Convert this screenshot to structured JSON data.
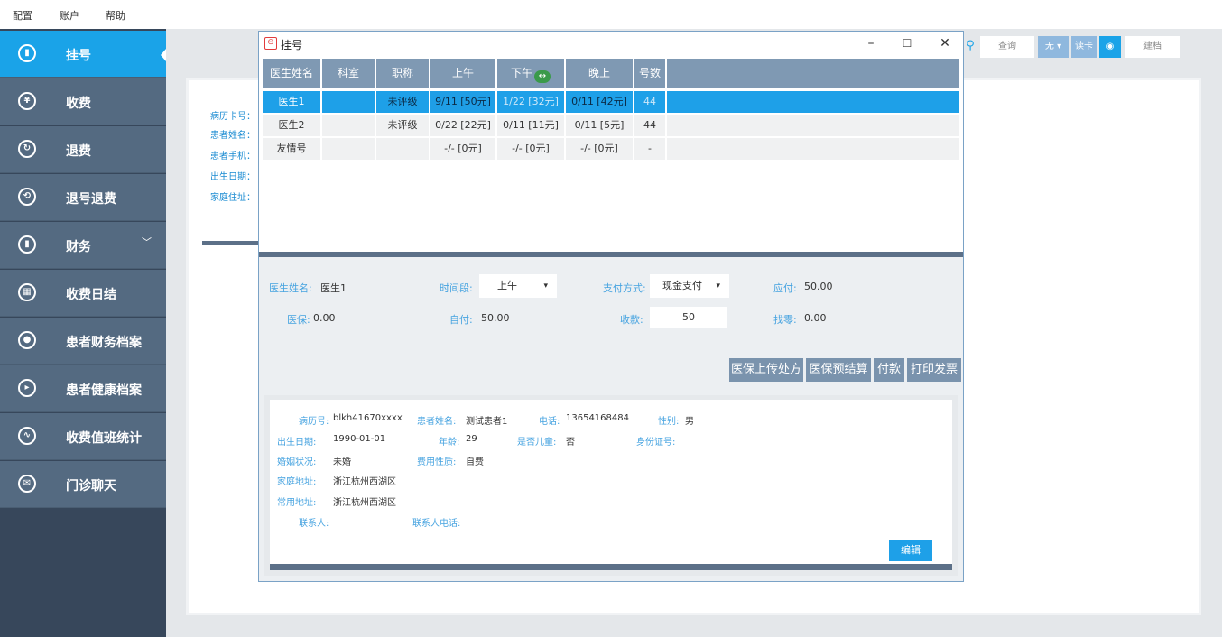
{
  "menu": {
    "config": "配置",
    "account": "账户",
    "help": "帮助"
  },
  "sidebar": {
    "items": [
      {
        "label": "挂号",
        "icon": "¥"
      },
      {
        "label": "收费"
      },
      {
        "label": "退费"
      },
      {
        "label": "退号退费"
      },
      {
        "label": "财务"
      },
      {
        "label": "收费日结"
      },
      {
        "label": "患者财务档案"
      },
      {
        "label": "患者健康档案"
      },
      {
        "label": "收费值班统计"
      },
      {
        "label": "门诊聊天"
      }
    ],
    "chevron": "﹀"
  },
  "background": {
    "labels": [
      "病历卡号：",
      "患者姓名：",
      "患者手机：",
      "出生日期：",
      "家庭住址："
    ],
    "toolbar": {
      "query": "查询",
      "none": "无",
      "read_card": "读卡",
      "create_file": "建档"
    }
  },
  "modal": {
    "title": "挂号",
    "controls": {
      "minimize": "–",
      "maximize": "☐",
      "close": "✕"
    },
    "grid": {
      "headers": [
        "医生姓名",
        "科室",
        "职称",
        "上午",
        "下午",
        "晚上",
        "号数"
      ],
      "rows": [
        [
          "医生1",
          "",
          "未评级",
          "9/11 [50元]",
          "1/22 [32元]",
          "0/11 [42元]",
          "44"
        ],
        [
          "医生2",
          "",
          "未评级",
          "0/22 [22元]",
          "0/11 [11元]",
          "0/11 [5元]",
          "44"
        ],
        [
          "友情号",
          "",
          "",
          "-/- [0元]",
          "-/- [0元]",
          "-/- [0元]",
          "-"
        ]
      ]
    },
    "form": {
      "doctor_label": "医生姓名:",
      "doctor_value": "医生1",
      "period_label": "时间段:",
      "period_value": "上午",
      "pay_label": "支付方式:",
      "pay_value": "现金支付",
      "due_label": "应付:",
      "due_value": "50.00",
      "insurance_label": "医保:",
      "insurance_value": "0.00",
      "self_label": "自付:",
      "self_value": "50.00",
      "received_label": "收款:",
      "received_value": "50",
      "change_label": "找零:",
      "change_value": "0.00"
    },
    "buttons": {
      "upload": "医保上传处方",
      "presettle": "医保预结算",
      "pay": "付款",
      "print": "打印发票"
    },
    "patient": {
      "record_label": "病历号:",
      "record_value": "blkh41670xxxx",
      "name_label": "患者姓名:",
      "name_value": "测试患者1",
      "phone_label": "电话:",
      "phone_value": "13654168484",
      "gender_label": "性别:",
      "gender_value": "男",
      "birth_label": "出生日期:",
      "birth_value": "1990-01-01",
      "age_label": "年龄:",
      "age_value": "29",
      "child_label": "是否儿童:",
      "child_value": "否",
      "id_label": "身份证号:",
      "id_value": "",
      "marital_label": "婚姻状况:",
      "marital_value": "未婚",
      "fee_label": "费用性质:",
      "fee_value": "自费",
      "home_label": "家庭地址:",
      "home_value": "浙江杭州西湖区",
      "common_label": "常用地址:",
      "common_value": "浙江杭州西湖区",
      "contact_label": "联系人:",
      "contact_value": "",
      "contact_phone_label": "联系人电话:",
      "contact_phone_value": "",
      "edit": "编辑"
    }
  }
}
